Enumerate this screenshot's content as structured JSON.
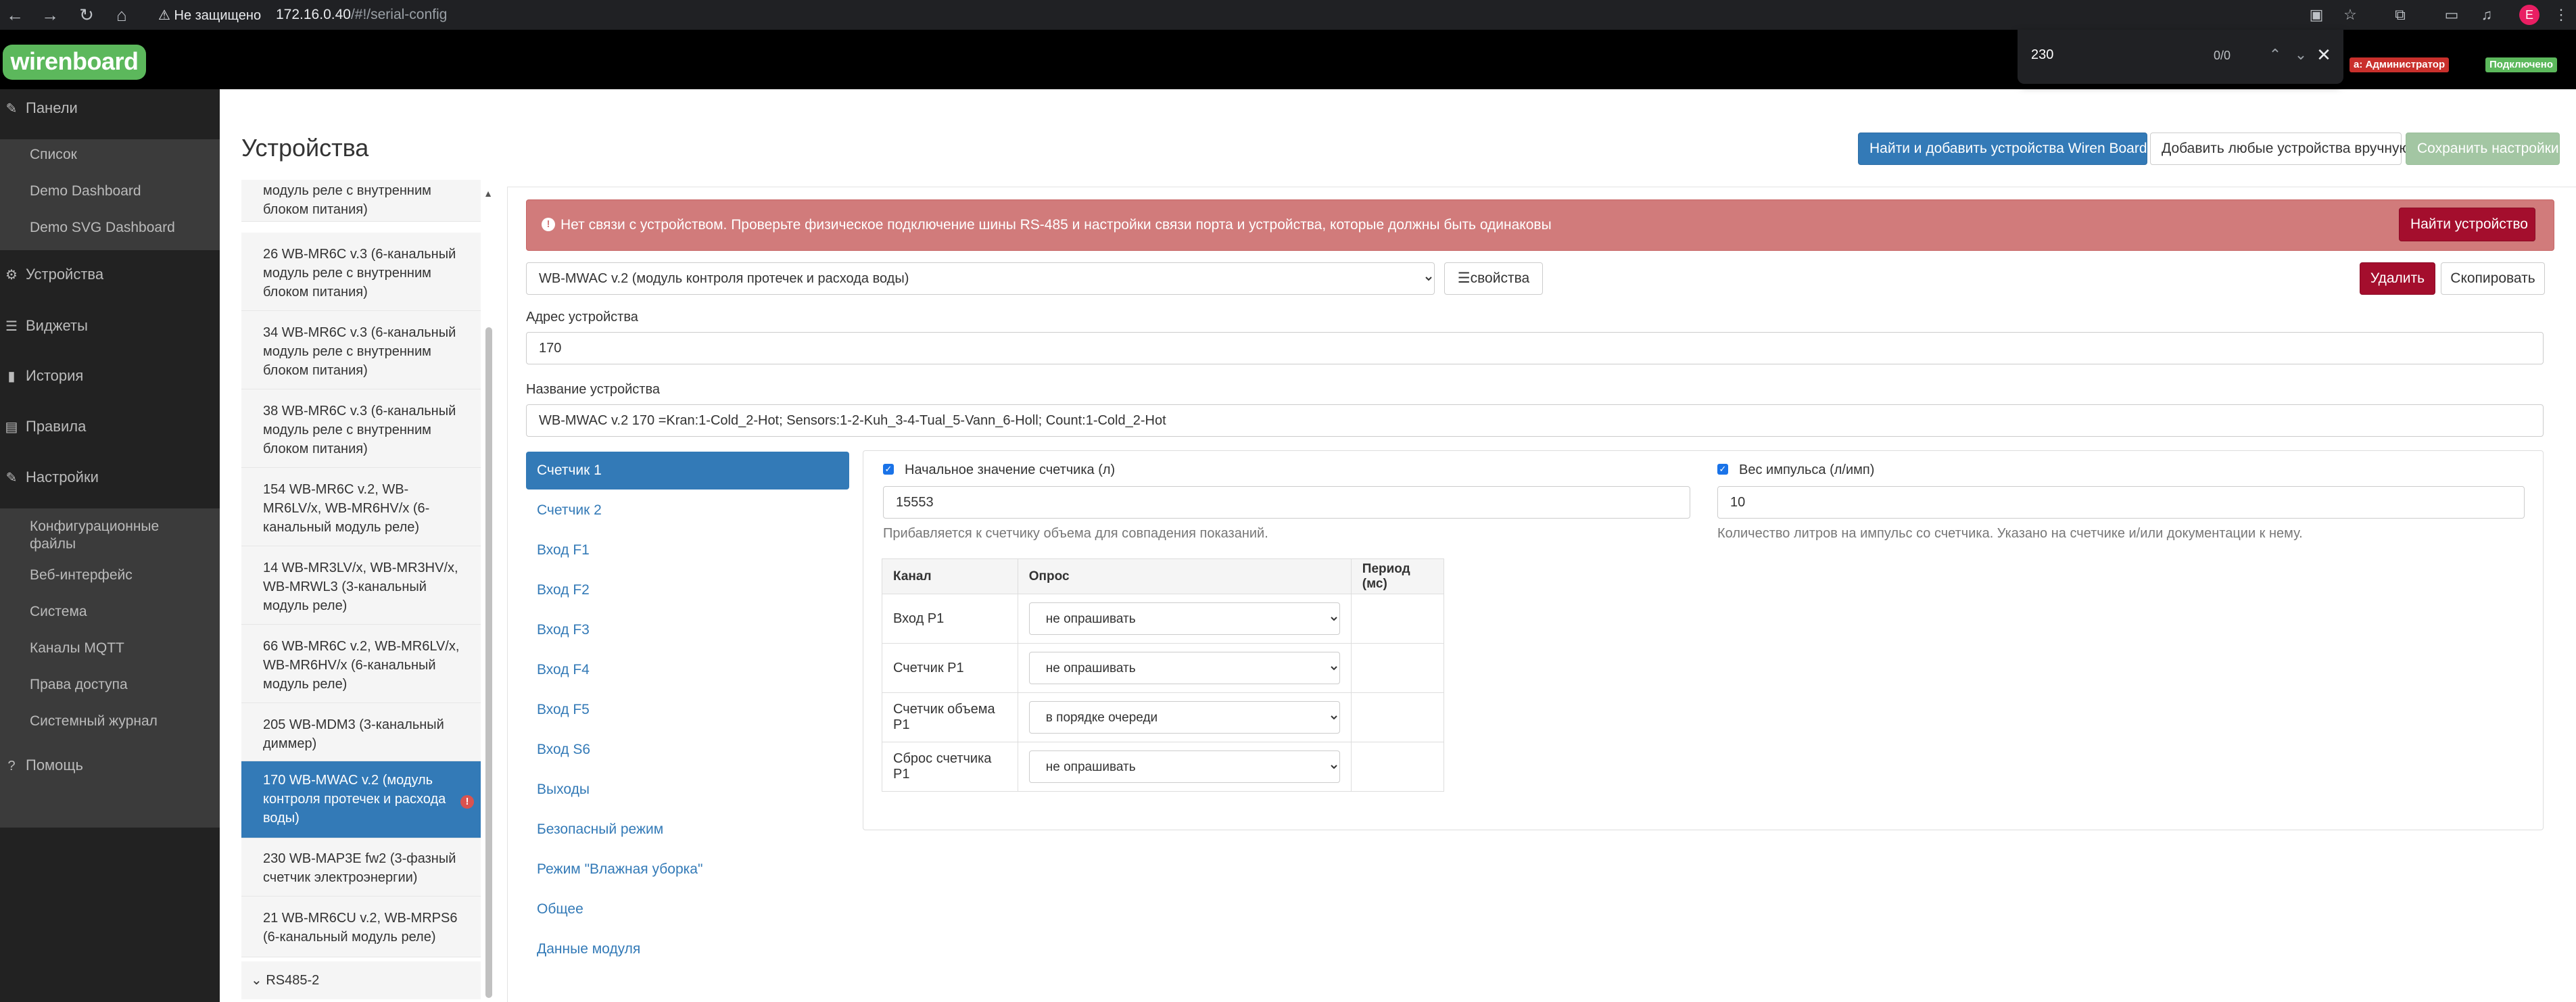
{
  "browser": {
    "security_label": "Не защищено",
    "url_host": "172.16.0.40",
    "url_path": "/#!/serial-config",
    "profile_initial": "E"
  },
  "find_bar": {
    "query": "230",
    "count": "0/0"
  },
  "navbar": {
    "logo": "wirenboard",
    "user_badge": "а: Администратор",
    "connection_badge": "Подключено"
  },
  "sidebar": {
    "panels": "Панели",
    "panels_items": [
      "Список",
      "Demo Dashboard",
      "Demo SVG Dashboard"
    ],
    "devices": "Устройства",
    "widgets": "Виджеты",
    "history": "История",
    "rules": "Правила",
    "settings": "Настройки",
    "settings_items": [
      "Конфигурационные файлы",
      "Веб-интерфейс",
      "Система",
      "Каналы MQTT",
      "Права доступа",
      "Системный журнал"
    ],
    "help": "Помощь"
  },
  "page": {
    "title": "Устройства",
    "btn_find_wb": "Найти и добавить устройства Wiren Board",
    "btn_add_manual": "Добавить любые устройства вручную",
    "btn_save": "Сохранить настройки"
  },
  "device_list": [
    "модуль реле с внутренним блоком питания)",
    "26 WB-MR6C v.3 (6-канальный модуль реле с внутренним блоком питания)",
    "34 WB-MR6C v.3 (6-канальный модуль реле с внутренним блоком питания)",
    "38 WB-MR6C v.3 (6-канальный модуль реле с внутренним блоком питания)",
    "154 WB-MR6C v.2, WB-MR6LV/x, WB-MR6HV/x (6-канальный модуль реле)",
    "14 WB-MR3LV/x, WB-MR3HV/x, WB-MRWL3 (3-канальный модуль реле)",
    "66 WB-MR6C v.2, WB-MR6LV/x, WB-MR6HV/x (6-канальный модуль реле)",
    "205 WB-MDM3 (3-канальный диммер)",
    "170 WB-MWAC v.2 (модуль контроля протечек и расхода воды)",
    "230 WB-MAP3E fw2 (3-фазный счетчик электроэнергии)",
    "21 WB-MR6CU v.2, WB-MRPS6 (6-канальный модуль реле)"
  ],
  "device_group": "RS485-2",
  "device": {
    "alert": "Нет связи с устройством. Проверьте физическое подключение шины RS-485 и настройки связи порта и устройства, которые должны быть одинаковы",
    "btn_find_device": "Найти устройство",
    "type": "WB-MWAC v.2 (модуль контроля протечек и расхода воды)",
    "btn_props": "свойства",
    "btn_delete": "Удалить",
    "btn_copy": "Скопировать",
    "address_label": "Адрес устройства",
    "address": "170",
    "name_label": "Название устройства",
    "name": "WB-MWAC v.2 170 =Kran:1-Cold_2-Hot; Sensors:1-2-Kuh_3-4-Tual_5-Vann_6-Holl; Count:1-Cold_2-Hot"
  },
  "channel_tabs": [
    "Счетчик 1",
    "Счетчик 2",
    "Вход F1",
    "Вход F2",
    "Вход F3",
    "Вход F4",
    "Вход F5",
    "Вход S6",
    "Выходы",
    "Безопасный режим",
    "Режим \"Влажная уборка\"",
    "Общее",
    "Данные модуля"
  ],
  "counter": {
    "initial_label": "Начальное значение счетчика (л)",
    "initial_value": "15553",
    "initial_help": "Прибавляется к счетчику объема для совпадения показаний.",
    "weight_label": "Вес импульса (л/имп)",
    "weight_value": "10",
    "weight_help": "Количество литров на импульс со счетчика. Указано на счетчике и/или документации к нему."
  },
  "table": {
    "headers": [
      "Канал",
      "Опрос",
      "Период (мс)"
    ],
    "rows": [
      {
        "channel": "Вход P1",
        "poll": "не опрашивать"
      },
      {
        "channel": "Счетчик P1",
        "poll": "не опрашивать"
      },
      {
        "channel": "Счетчик объема P1",
        "poll": "в порядке очереди"
      },
      {
        "channel": "Сброс счетчика P1",
        "poll": "не опрашивать"
      }
    ]
  }
}
